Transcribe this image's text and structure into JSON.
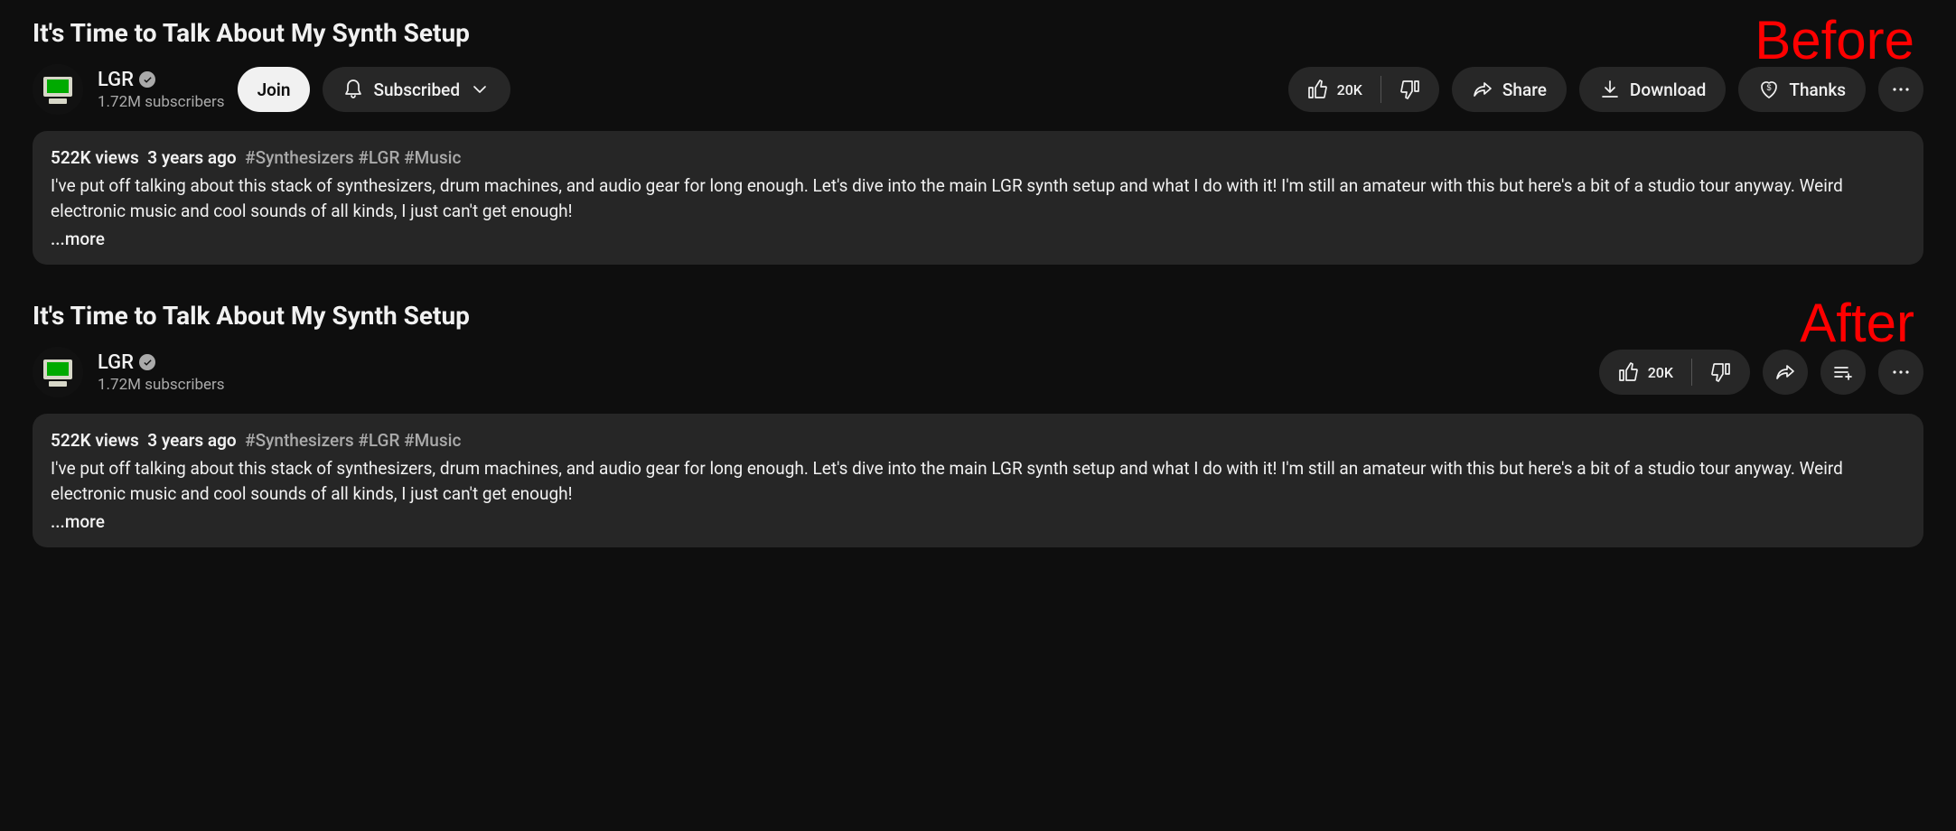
{
  "labels": {
    "before": "Before",
    "after": "After"
  },
  "video": {
    "title": "It's Time to Talk About My Synth Setup",
    "channel": {
      "name": "LGR",
      "subscribers": "1.72M subscribers"
    },
    "likes": "20K",
    "buttons": {
      "join": "Join",
      "subscribed": "Subscribed",
      "share": "Share",
      "download": "Download",
      "thanks": "Thanks"
    },
    "description": {
      "views": "522K views",
      "age": "3 years ago",
      "tags": "#Synthesizers #LGR #Music",
      "body": "I've put off talking about this stack of synthesizers, drum machines, and audio gear for long enough. Let's dive into the main LGR synth setup and what I do with it! I'm still an amateur with this but here's a bit of a studio tour anyway. Weird electronic music and cool sounds of all kinds, I just can't get enough!",
      "more": "...more"
    }
  }
}
